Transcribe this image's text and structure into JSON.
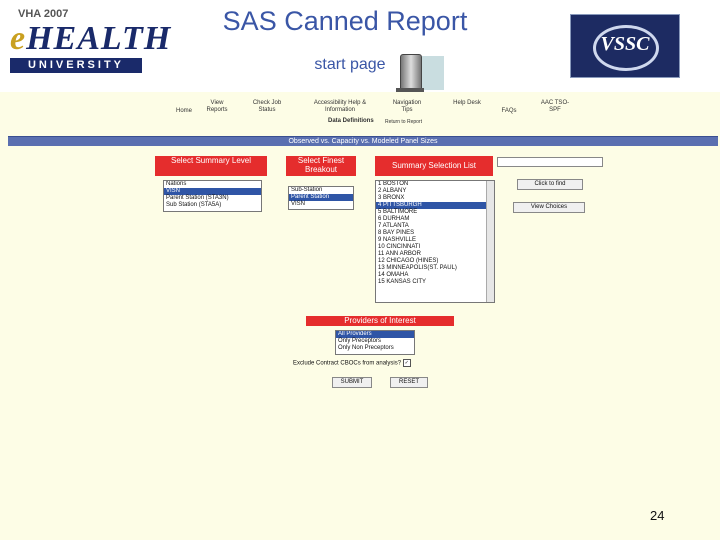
{
  "slide": {
    "title": "SAS Canned Report",
    "subtitle": "start page",
    "page_number": "24"
  },
  "logos": {
    "vha": "VHA 2007",
    "ehealth": "HEALTH",
    "ehealth_e": "e",
    "university": "UNIVERSITY",
    "vssc": "VSSC"
  },
  "nav": {
    "items": [
      {
        "label": "Home"
      },
      {
        "label": "View Reports"
      },
      {
        "label": "Check Job Status"
      },
      {
        "label": "Accessibility Help & Information"
      },
      {
        "label": "Navigation Tips"
      },
      {
        "label": "Help Desk"
      },
      {
        "label": "FAQs"
      },
      {
        "label": "AAC TSO-SPF"
      }
    ],
    "data_definitions": "Data Definitions",
    "return_to_report": "Return to Report"
  },
  "report_bar": "Observed vs. Capacity vs. Modeled Panel Sizes",
  "summary_level": {
    "header": "Select Summary Level",
    "options": [
      "Nations",
      "VISN",
      "Parent Station (STA3N)",
      "Sub Station (STA5A)"
    ],
    "selected_index": 1
  },
  "finest_breakout": {
    "header": "Select Finest Breakout",
    "options": [
      "Sub-Station",
      "Parent Station",
      "VISN"
    ],
    "selected_index": 1
  },
  "selection_list": {
    "header": "Summary Selection List",
    "options": [
      "1 BOSTON",
      "2 ALBANY",
      "3 BRONX",
      "4 PITTSBURGH",
      "5 BALTIMORE",
      "6 DURHAM",
      "7 ATLANTA",
      "8 BAY PINES",
      "9 NASHVILLE",
      "10 CINCINNATI",
      "11 ANN ARBOR",
      "12 CHICAGO (HINES)",
      "13 MINNEAPOLIS(ST. PAUL)",
      "14 OMAHA",
      "15 KANSAS CITY"
    ],
    "selected_index": 3
  },
  "buttons": {
    "click_to_find": "Click to find",
    "view_choices": "View Choices",
    "submit": "SUBMIT",
    "reset": "RESET"
  },
  "providers": {
    "header": "Providers of Interest",
    "options": [
      "All Providers",
      "Only Preceptors",
      "Only Non Preceptors"
    ],
    "selected_index": 0
  },
  "exclude_label": "Exclude Contract CBOCs from analysis?",
  "exclude_checked": true
}
